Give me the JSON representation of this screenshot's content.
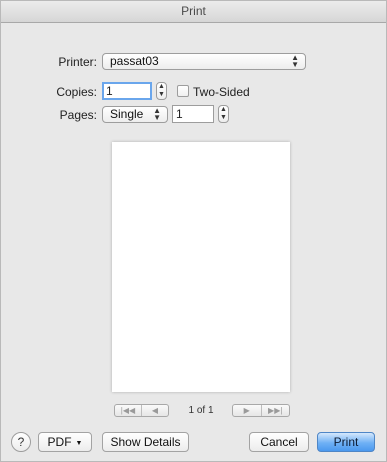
{
  "window": {
    "title": "Print"
  },
  "printer": {
    "label": "Printer:",
    "value": "passat03"
  },
  "copies": {
    "label": "Copies:",
    "value": "1"
  },
  "two_sided": {
    "label": "Two-Sided",
    "checked": false
  },
  "pages": {
    "label": "Pages:",
    "mode": "Single",
    "page_number": "1"
  },
  "preview": {
    "page_indicator": "1 of 1",
    "first_icon": "first-page-icon",
    "prev_icon": "previous-page-icon",
    "next_icon": "next-page-icon",
    "last_icon": "last-page-icon"
  },
  "footer": {
    "help_label": "?",
    "pdf_label": "PDF",
    "show_details_label": "Show Details",
    "cancel_label": "Cancel",
    "print_label": "Print"
  },
  "colors": {
    "default_button": "#4b98ee",
    "focus_ring": "#6aa6ec"
  }
}
